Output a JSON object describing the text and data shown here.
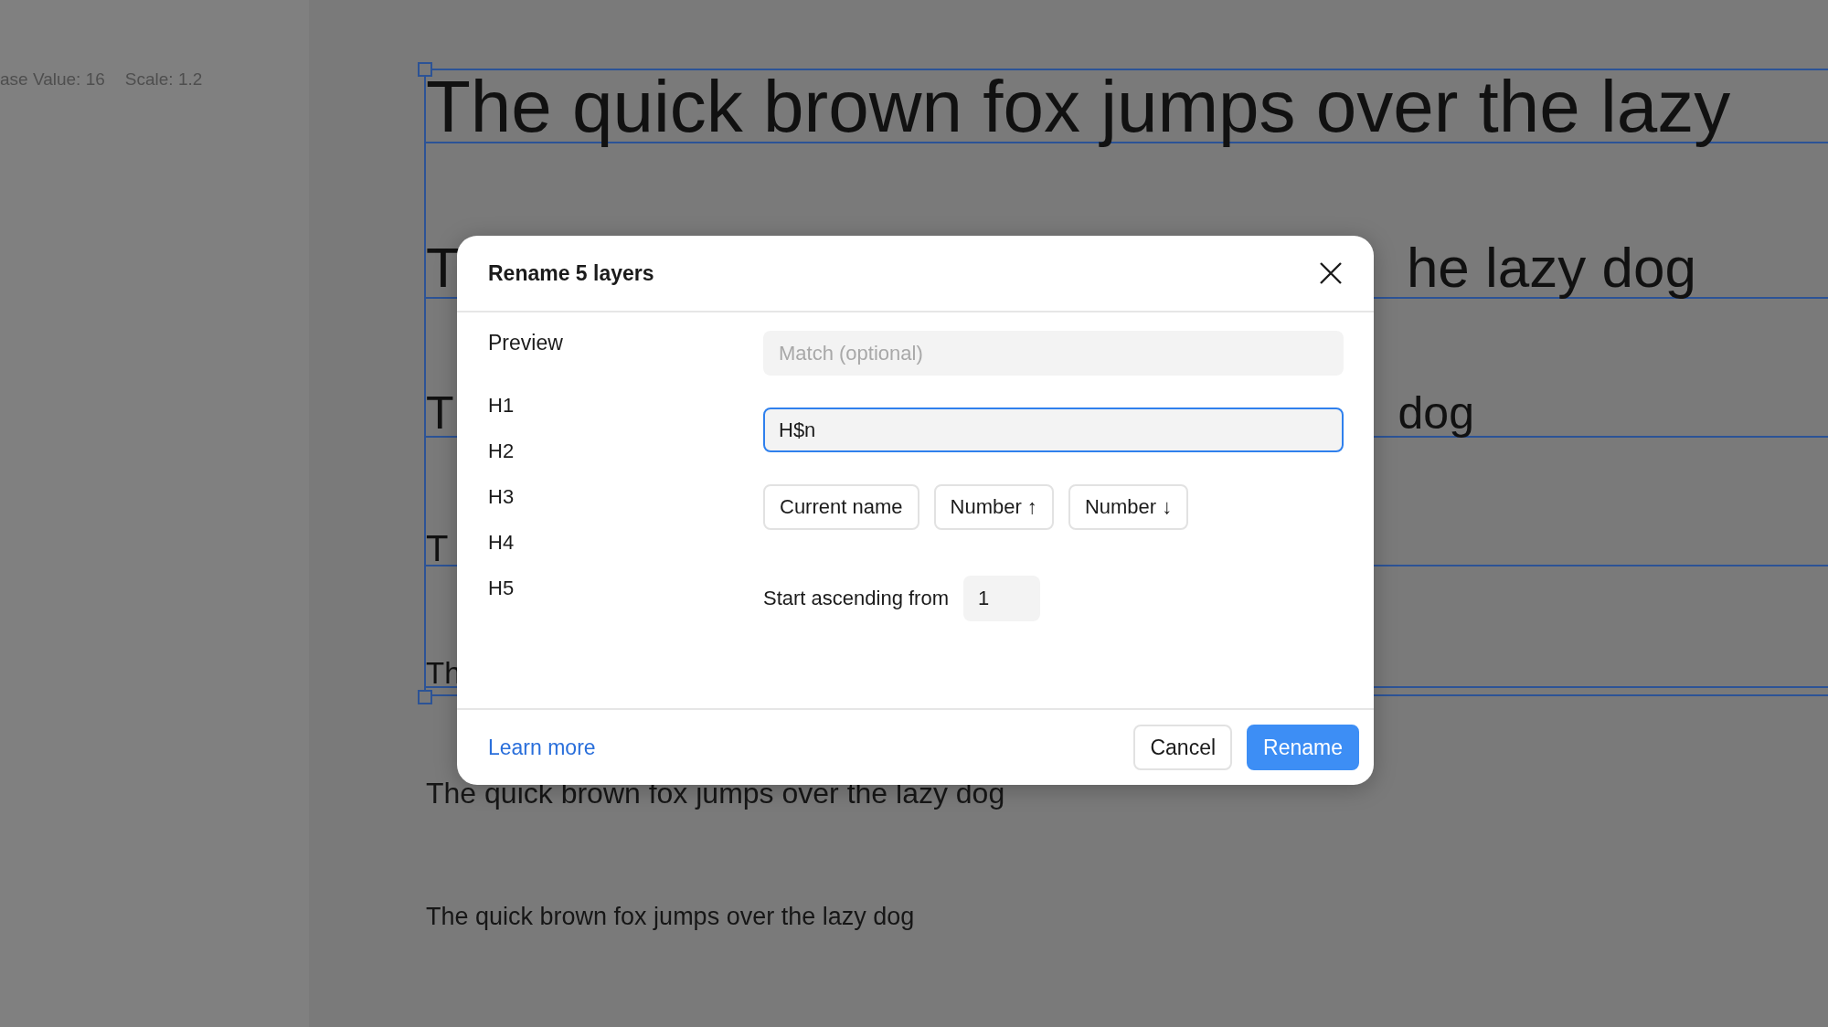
{
  "sidebar": {
    "labels": [
      "ase Value: 16",
      "Scale: 1.2"
    ]
  },
  "canvas": {
    "selected_layers": [
      {
        "fragments": [
          "The quick brown fox jumps over the lazy"
        ]
      },
      {
        "fragments": [
          "T",
          "he lazy dog"
        ]
      },
      {
        "fragments": [
          "T",
          "dog"
        ]
      },
      {
        "fragments": [
          "T"
        ]
      },
      {
        "fragments": [
          "Th"
        ]
      }
    ],
    "layers": [
      "The quick brown fox jumps over the lazy dog",
      "The quick brown fox jumps over the lazy dog"
    ]
  },
  "dialog": {
    "title": "Rename 5 layers",
    "preview": {
      "label": "Preview",
      "items": [
        "H1",
        "H2",
        "H3",
        "H4",
        "H5"
      ]
    },
    "match_field": {
      "placeholder": "Match (optional)"
    },
    "rename_field": {
      "value": "H$n",
      "focused": true
    },
    "tokens": [
      "Current name",
      "Number ↑",
      "Number ↓"
    ],
    "start": {
      "label": "Start ascending from",
      "value": "1"
    },
    "learn_more": "Learn more",
    "buttons": [
      {
        "label": "Cancel",
        "kind": "secondary"
      },
      {
        "label": "Rename",
        "kind": "primary"
      }
    ]
  }
}
